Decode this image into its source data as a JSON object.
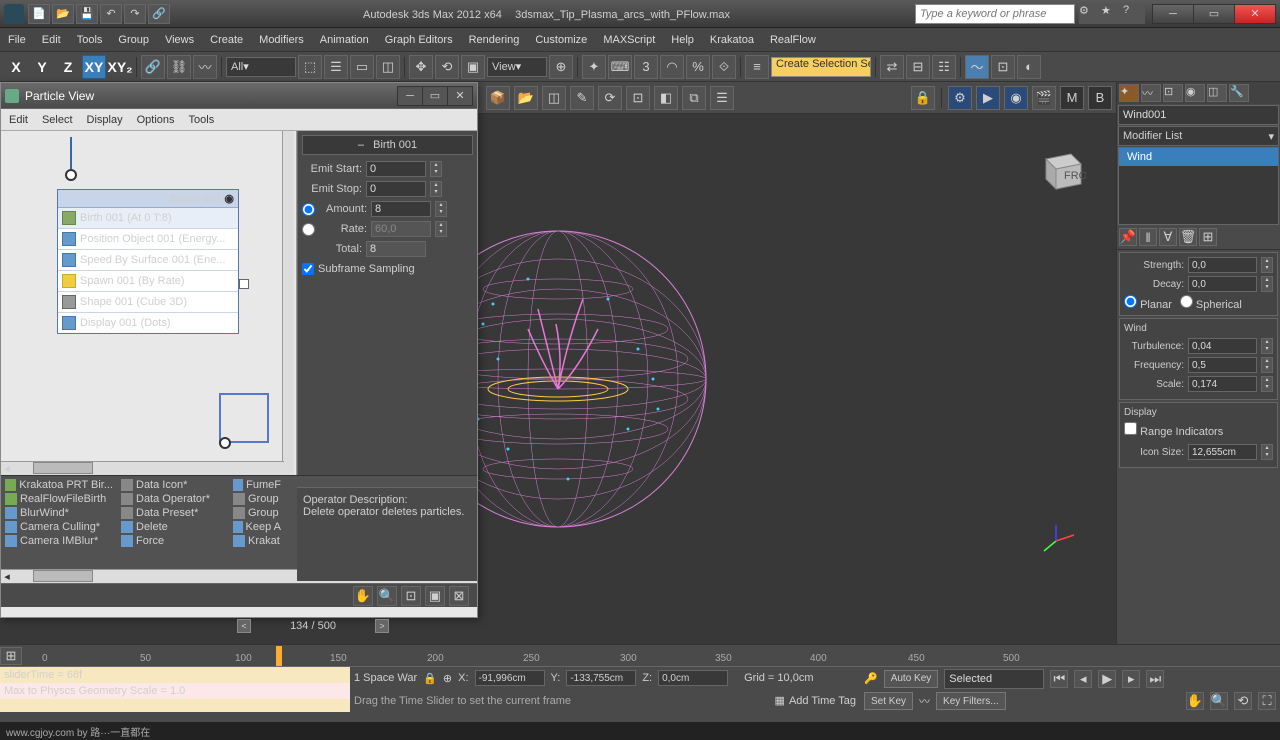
{
  "title": {
    "app": "Autodesk 3ds Max  2012 x64",
    "file": "3dsmax_Tip_Plasma_arcs_with_PFlow.max"
  },
  "search": {
    "placeholder": "Type a keyword or phrase"
  },
  "menubar": [
    "File",
    "Edit",
    "Tools",
    "Group",
    "Views",
    "Create",
    "Modifiers",
    "Animation",
    "Graph Editors",
    "Rendering",
    "Customize",
    "MAXScript",
    "Help",
    "Krakatoa",
    "RealFlow"
  ],
  "toolbar1": {
    "axes": [
      "X",
      "Y",
      "Z",
      "XY",
      "XY₂"
    ],
    "filter": "All",
    "view": "View",
    "selset": "Create Selection Se"
  },
  "particle_view": {
    "title": "Particle View",
    "menu": [
      "Edit",
      "Select",
      "Display",
      "Options",
      "Tools"
    ],
    "event": {
      "name": "Event 001",
      "items": [
        {
          "icon": "green",
          "label": "Birth 001 (At 0 T:8)"
        },
        {
          "icon": "blue",
          "label": "Position Object 001 (Energy..."
        },
        {
          "icon": "blue",
          "label": "Speed By Surface 001 (Ene..."
        },
        {
          "icon": "yel",
          "label": "Spawn 001 (By Rate)"
        },
        {
          "icon": "gray",
          "label": "Shape 001 (Cube 3D)"
        },
        {
          "icon": "blue",
          "label": "Display 001 (Dots)"
        }
      ]
    },
    "props": {
      "title": "Birth 001",
      "emit_start": "0",
      "emit_stop": "0",
      "amount": "8",
      "rate": "60,0",
      "total": "8",
      "subframe": "Subframe Sampling",
      "labels": {
        "emit_start": "Emit Start:",
        "emit_stop": "Emit Stop:",
        "amount": "Amount:",
        "rate": "Rate:",
        "total": "Total:"
      }
    },
    "depot": {
      "col1": [
        "Krakatoa PRT Bir...",
        "RealFlowFileBirth",
        "BlurWind*",
        "Camera Culling*",
        "Camera IMBlur*"
      ],
      "col2": [
        "Data Icon*",
        "Data Operator*",
        "Data Preset*",
        "Delete",
        "Force"
      ],
      "col3": [
        "FumeF",
        "Group",
        "Group",
        "Keep A",
        "Krakat"
      ]
    },
    "desc": {
      "title": "Operator Description:",
      "body": "Delete operator deletes particles."
    },
    "slider": "134 / 500"
  },
  "right_panel": {
    "object": "Wind001",
    "modlist": "Modifier List",
    "stack_item": "Wind",
    "force": {
      "strength": "0,0",
      "decay": "0,0",
      "planar": "Planar",
      "spherical": "Spherical",
      "labels": {
        "strength": "Strength:",
        "decay": "Decay:"
      }
    },
    "wind": {
      "title": "Wind",
      "turbulence": "0,04",
      "frequency": "0,5",
      "scale": "0,174",
      "labels": {
        "turbulence": "Turbulence:",
        "frequency": "Frequency:",
        "scale": "Scale:"
      }
    },
    "display": {
      "title": "Display",
      "range": "Range Indicators",
      "icon_size": "12,655cm",
      "labels": {
        "icon_size": "Icon Size:"
      }
    }
  },
  "timeline": {
    "ticks": [
      "0",
      "50",
      "100",
      "150",
      "200",
      "250",
      "300",
      "350",
      "400",
      "450",
      "500"
    ],
    "positions": [
      42,
      140,
      235,
      330,
      427,
      523,
      620,
      715,
      810,
      908,
      1003
    ]
  },
  "status": {
    "script1": "sliderTime = 68f",
    "script2": "Max to Physcs Geometry Scale = 1.0",
    "spacewarp": "1 Space War",
    "x": "-91,996cm",
    "y": "-133,755cm",
    "z": "0,0cm",
    "grid": "Grid = 10,0cm",
    "hint": "Drag the Time Slider to set the current frame",
    "timetag": "Add Time Tag",
    "autokey": "Auto Key",
    "setkey": "Set Key",
    "selected": "Selected",
    "keyfilters": "Key Filters..."
  },
  "footer": "www.cgjoy.com by 路···一直都在"
}
